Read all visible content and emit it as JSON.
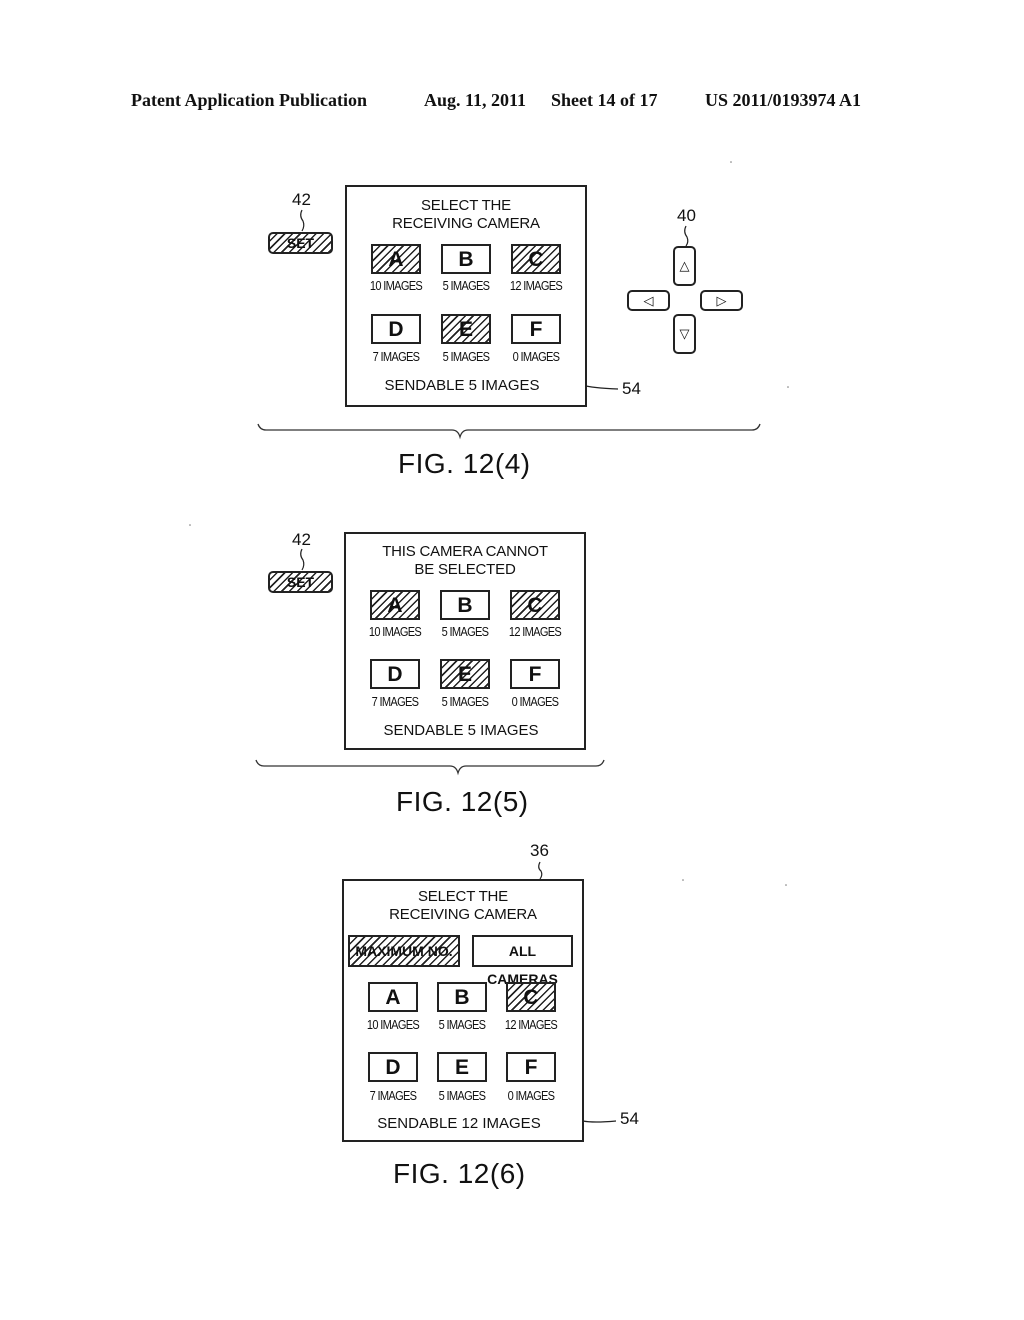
{
  "header": {
    "publication": "Patent Application Publication",
    "date": "Aug. 11, 2011",
    "sheet": "Sheet 14 of 17",
    "patent_number": "US 2011/0193974 A1"
  },
  "figures": [
    {
      "label": "FIG. 12(4)",
      "set_button": {
        "ref": "42",
        "label": "SET",
        "pressed": true
      },
      "screen": {
        "title_line1": "SELECT THE",
        "title_line2": "RECEIVING CAMERA",
        "cameras": [
          {
            "letter": "A",
            "count": "10 IMAGES",
            "hatched": true
          },
          {
            "letter": "B",
            "count": "5 IMAGES",
            "hatched": false
          },
          {
            "letter": "C",
            "count": "12 IMAGES",
            "hatched": true
          },
          {
            "letter": "D",
            "count": "7 IMAGES",
            "hatched": false
          },
          {
            "letter": "E",
            "count": "5 IMAGES",
            "hatched": true
          },
          {
            "letter": "F",
            "count": "0 IMAGES",
            "hatched": false
          }
        ],
        "sendable": "SENDABLE 5 IMAGES",
        "sendable_ref": "54"
      },
      "dpad": {
        "ref": "40",
        "up": {
          "glyph": "△",
          "hatched": false
        },
        "left": {
          "glyph": "◁",
          "hatched": false
        },
        "right": {
          "glyph": "▷",
          "hatched": true
        },
        "down": {
          "glyph": "▽",
          "hatched": true
        }
      }
    },
    {
      "label": "FIG. 12(5)",
      "set_button": {
        "ref": "42",
        "label": "SET",
        "pressed": true
      },
      "screen": {
        "title_line1": "THIS CAMERA CANNOT",
        "title_line2": "BE SELECTED",
        "cameras": [
          {
            "letter": "A",
            "count": "10 IMAGES",
            "hatched": true
          },
          {
            "letter": "B",
            "count": "5 IMAGES",
            "hatched": false
          },
          {
            "letter": "C",
            "count": "12 IMAGES",
            "hatched": true
          },
          {
            "letter": "D",
            "count": "7 IMAGES",
            "hatched": false
          },
          {
            "letter": "E",
            "count": "5 IMAGES",
            "hatched": true
          },
          {
            "letter": "F",
            "count": "0 IMAGES",
            "hatched": false
          }
        ],
        "sendable": "SENDABLE 5 IMAGES"
      }
    },
    {
      "label": "FIG. 12(6)",
      "screen": {
        "ref": "36",
        "title_line1": "SELECT THE",
        "title_line2": "RECEIVING CAMERA",
        "max_button": {
          "label": "MAXIMUM NO.",
          "hatched": true
        },
        "all_button": {
          "label": "ALL CAMERAS",
          "hatched": false
        },
        "cameras": [
          {
            "letter": "A",
            "count": "10 IMAGES",
            "hatched": false
          },
          {
            "letter": "B",
            "count": "5 IMAGES",
            "hatched": false
          },
          {
            "letter": "C",
            "count": "12 IMAGES",
            "hatched": true
          },
          {
            "letter": "D",
            "count": "7 IMAGES",
            "hatched": false
          },
          {
            "letter": "E",
            "count": "5 IMAGES",
            "hatched": false
          },
          {
            "letter": "F",
            "count": "0 IMAGES",
            "hatched": false
          }
        ],
        "sendable": "SENDABLE 12 IMAGES",
        "sendable_ref": "54"
      }
    }
  ]
}
